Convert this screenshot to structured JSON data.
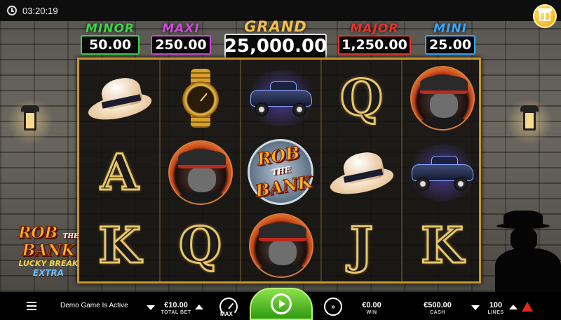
{
  "status_bar": {
    "time": "03:20:19"
  },
  "jackpots": {
    "minor": {
      "title": "MINOR",
      "value": "50.00",
      "color": "#3fd24a"
    },
    "maxi": {
      "title": "MAXI",
      "value": "250.00",
      "color": "#d04ad8"
    },
    "grand": {
      "title": "GRAND",
      "value": "25,000.00",
      "color": "#f2c04a"
    },
    "major": {
      "title": "MAJOR",
      "value": "1,250.00",
      "color": "#e8342a"
    },
    "mini": {
      "title": "MINI",
      "value": "25.00",
      "color": "#3aa6ff"
    }
  },
  "reels": {
    "columns": [
      [
        "fedora-hat-icon",
        "letter-a",
        "letter-k"
      ],
      [
        "gold-watch-icon",
        "gangster-icon",
        "letter-q"
      ],
      [
        "vintage-car-icon",
        "rob-the-bank-wild",
        "gangster-icon"
      ],
      [
        "letter-q",
        "fedora-hat-icon",
        "letter-j"
      ],
      [
        "gangster-icon",
        "vintage-car-icon",
        "letter-k"
      ]
    ],
    "letters": {
      "a": "A",
      "k": "K",
      "q": "Q",
      "j": "J"
    },
    "wild": {
      "line1": "ROB",
      "the": "THE",
      "line2": "BANK"
    }
  },
  "logo": {
    "main1": "ROB",
    "the": "THE",
    "main2": "BANK",
    "sub": "LUCKY BREAK",
    "extra": "EXTRA"
  },
  "controls": {
    "demo_text": "Demo Game Is Active",
    "total_bet_value": "€10.00",
    "total_bet_label": "TOTAL BET",
    "max_label": "MAX",
    "win_value": "€0.00",
    "win_label": "WIN",
    "cash_value": "€500.00",
    "cash_label": "CASH",
    "lines_value": "100",
    "lines_label": "LINES"
  },
  "colors": {
    "frame": "#c9962b",
    "spin": "#3fa81a",
    "brand": "#e0281c"
  }
}
